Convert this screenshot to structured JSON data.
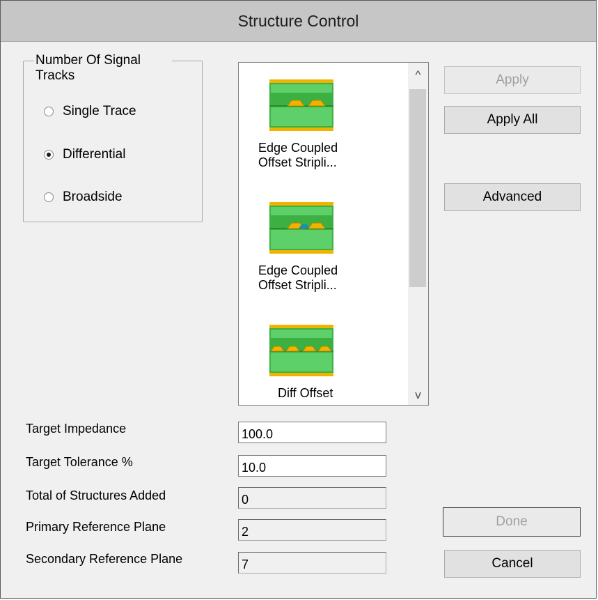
{
  "window": {
    "title": "Structure Control"
  },
  "signal_tracks": {
    "legend": "Number Of Signal Tracks",
    "options": [
      {
        "label": "Single Trace",
        "checked": false
      },
      {
        "label": "Differential",
        "checked": true
      },
      {
        "label": "Broadside",
        "checked": false
      }
    ]
  },
  "structures": {
    "items": [
      {
        "label_line1": "Edge Coupled",
        "label_line2": "Offset Stripli...",
        "icon": "edge-coupled-offset-stripline-icon"
      },
      {
        "label_line1": "Edge Coupled",
        "label_line2": "Offset Stripli...",
        "icon": "edge-coupled-offset-stripline-selected-icon"
      },
      {
        "label_line1": "Diff Offset",
        "label_line2": "",
        "icon": "diff-offset-stripline-icon"
      }
    ],
    "scroll_up_glyph": "^",
    "scroll_down_glyph": "v"
  },
  "buttons": {
    "apply": "Apply",
    "apply_all": "Apply All",
    "advanced": "Advanced",
    "done": "Done",
    "cancel": "Cancel"
  },
  "fields": [
    {
      "label": "Target Impedance",
      "value": "100.0",
      "editable": true
    },
    {
      "label": "Target Tolerance %",
      "value": "10.0",
      "editable": true
    },
    {
      "label": "Total of Structures Added",
      "value": "0",
      "editable": false
    },
    {
      "label": "Primary Reference Plane",
      "value": "2",
      "editable": false
    },
    {
      "label": "Secondary Reference Plane",
      "value": "7",
      "editable": false
    }
  ],
  "colors": {
    "dielectric_green": "#3cb043",
    "copper_yellow": "#f0b400",
    "trace_highlight": "#1a8fb0"
  }
}
